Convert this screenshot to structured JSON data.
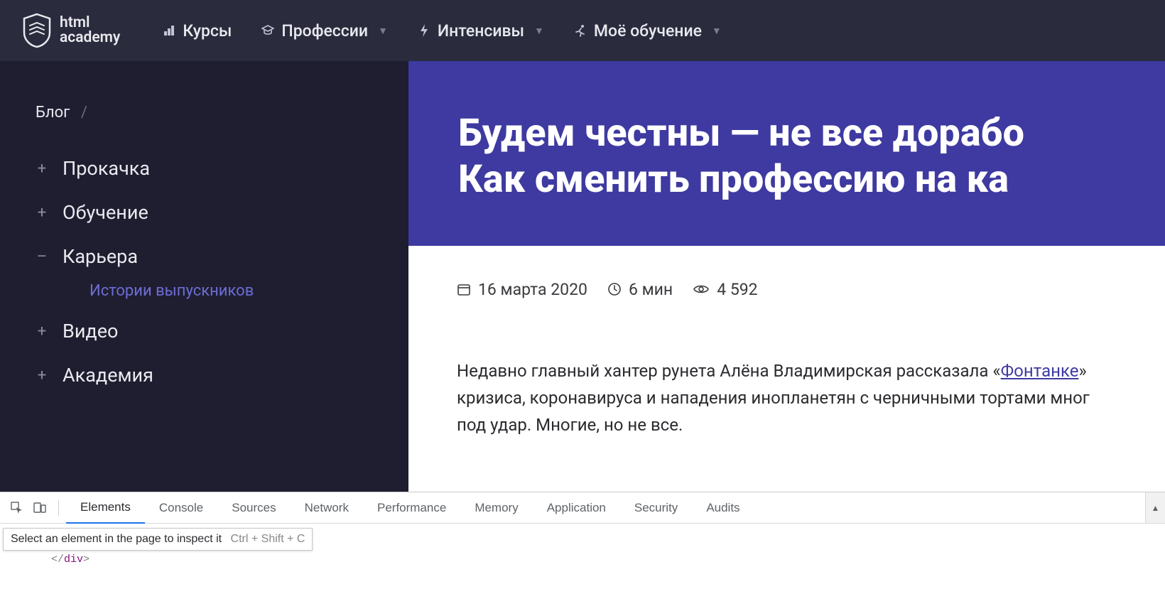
{
  "brand": {
    "line1": "html",
    "line2": "academy"
  },
  "nav": [
    {
      "label": "Курсы",
      "dropdown": false,
      "icon": "bars-icon"
    },
    {
      "label": "Профессии",
      "dropdown": true,
      "icon": "graduation-icon"
    },
    {
      "label": "Интенсивы",
      "dropdown": true,
      "icon": "lightning-icon"
    },
    {
      "label": "Моё обучение",
      "dropdown": true,
      "icon": "user-running-icon"
    }
  ],
  "breadcrumb": {
    "root": "Блог",
    "sep": "/"
  },
  "sidebar": [
    {
      "label": "Прокачка",
      "expanded": false
    },
    {
      "label": "Обучение",
      "expanded": false
    },
    {
      "label": "Карьера",
      "expanded": true,
      "sub": [
        "Истории выпускников"
      ]
    },
    {
      "label": "Видео",
      "expanded": false
    },
    {
      "label": "Академия",
      "expanded": false
    }
  ],
  "article": {
    "title_line1": "Будем честны — не все дорабо",
    "title_line2": "Как сменить профессию на ка",
    "date": "16 марта 2020",
    "read_time": "6 мин",
    "views": "4 592",
    "body_prefix": "Недавно главный хантер рунета Алёна Владимирская рассказала «",
    "body_link": "Фонтанке",
    "body_after_link_1": "»",
    "body_line2": "кризиса, коронавируса и нападения инопланетян с черничными тортами мног",
    "body_line3": "под удар. Многие, но не все."
  },
  "devtools": {
    "tabs": [
      "Elements",
      "Console",
      "Sources",
      "Network",
      "Performance",
      "Memory",
      "Application",
      "Security",
      "Audits"
    ],
    "active_tab": "Elements",
    "tooltip_text": "Select an element in the page to inspect it",
    "tooltip_shortcut": "Ctrl + Shift + C",
    "code_fragment_tag": "div"
  }
}
